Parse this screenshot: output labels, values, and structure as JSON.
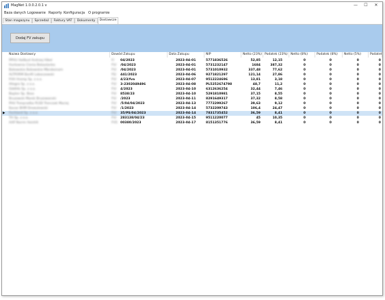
{
  "app": {
    "title": "MagNet 1.0.0.2.0.1 v"
  },
  "window_buttons": {
    "minimize": "—",
    "maximize": "☐",
    "close": "✕"
  },
  "menu": [
    "Baza danych",
    "Logowanie",
    "Raporty",
    "Konfiguracja",
    "O programie"
  ],
  "tabs": [
    {
      "label": "Stan magazynu",
      "active": false
    },
    {
      "label": "Sprzedaż",
      "active": false
    },
    {
      "label": "Faktury VAT",
      "active": false
    },
    {
      "label": "Dokumenty",
      "active": false
    },
    {
      "label": "Dostawcze",
      "active": true
    }
  ],
  "toolbar": {
    "add_button": "Dodaj FV zakupu"
  },
  "table": {
    "columns": [
      "Nazwa Dostawcy",
      "Dowód Zakupu",
      "Data Zakupu",
      "NIP",
      "Netto (23%)",
      "Podatek (23%)",
      "Netto (8%)",
      "Podatek (8%)",
      "Netto (5%)",
      "Podatek"
    ],
    "rows": [
      {
        "supplier": "PPHU Hallbud Andrzej Hibel",
        "doc_prefix": "F/",
        "doc": "04/2023",
        "date": "2023-04-01",
        "nip": "5771836526",
        "n23": "52,85",
        "p23": "12,15",
        "n8": "0",
        "p8": "0",
        "n5": "0",
        "p5": "0"
      },
      {
        "supplier": "Hurtownia Cienia Bekastanka",
        "doc_prefix": "FV/",
        "doc": "/04/2023",
        "date": "2023-04-01",
        "nip": "5731232147",
        "n23": "1684",
        "p23": "387,32",
        "n8": "0",
        "p8": "0",
        "n5": "0",
        "p5": "0"
      },
      {
        "supplier": "Bokowskie Bokowskie Mbrokeinzm",
        "doc_prefix": "FV/",
        "doc": "/04/2023",
        "date": "2023-04-01",
        "nip": "5731010932",
        "n23": "337,48",
        "p23": "77,62",
        "n8": "0",
        "p8": "0",
        "n5": "0",
        "p5": "0"
      },
      {
        "supplier": "ALTPORM Bonfil Loboczewski",
        "doc_prefix": "FS/",
        "doc": "441/2023",
        "date": "2023-04-06",
        "nip": "9271821297",
        "n23": "121,14",
        "p23": "27,86",
        "n8": "0",
        "p8": "0",
        "n5": "0",
        "p5": "0"
      },
      {
        "supplier": "FHH Hromp Sp. z o.o.",
        "doc_prefix": "FV/",
        "doc": "4/23/fva",
        "date": "2023-04-07",
        "nip": "9512224696",
        "n23": "13,81",
        "p23": "3,18",
        "n8": "0",
        "p8": "0",
        "n5": "0",
        "p5": "0"
      },
      {
        "supplier": "Allegro Sp. z o.o.",
        "doc_prefix": "FV/",
        "doc": "3-2302049496",
        "date": "2023-04-08",
        "nip": "PL5252674798",
        "n23": "48,7",
        "p23": "11,2",
        "n8": "0",
        "p8": "0",
        "n5": "0",
        "p5": "0"
      },
      {
        "supplier": "Oddhfo Sp. z o.o.",
        "doc_prefix": "FV/",
        "doc": "4/2023",
        "date": "2023-04-10",
        "nip": "6312636254",
        "n23": "32,44",
        "p23": "7,46",
        "n8": "0",
        "p8": "0",
        "n5": "0",
        "p5": "0"
      },
      {
        "supplier": "Beplen Sp. Boss",
        "doc_prefix": "FV/",
        "doc": "8538/23",
        "date": "2023-04-10",
        "nip": "5291810981",
        "n23": "37,15",
        "p23": "8,55",
        "n8": "0",
        "p8": "0",
        "n5": "0",
        "p5": "0"
      },
      {
        "supplier": "Bruzowski Marek Bruzowanski",
        "doc_prefix": "FV/",
        "doc": "/2023",
        "date": "2023-04-11",
        "nip": "8291649317",
        "n23": "37,32",
        "p23": "8,58",
        "n8": "0",
        "p8": "0",
        "n5": "0",
        "p5": "0"
      },
      {
        "supplier": "PHU Tronpradka PLSD Tronczak Maciej",
        "doc_prefix": "FV/",
        "doc": "/5/04/04/2023",
        "date": "2023-04-13",
        "nip": "7772299267",
        "n23": "39,63",
        "p23": "9,12",
        "n8": "0",
        "p8": "0",
        "n5": "0",
        "p5": "0"
      },
      {
        "supplier": "Kavax BHM Drewutewski",
        "doc_prefix": "FV/",
        "doc": "/1/2023",
        "date": "2023-04-14",
        "nip": "5732209743",
        "n23": "106,4",
        "p23": "24,47",
        "n8": "0",
        "p8": "0",
        "n5": "0",
        "p5": "0"
      },
      {
        "supplier": "Fechland Sp. z o.o.",
        "doc_prefix": "FV/",
        "doc": "35/PS/04/2023",
        "date": "2023-04-14",
        "nip": "7831735452",
        "n23": "36,59",
        "p23": "8,41",
        "n8": "0",
        "p8": "0",
        "n5": "0",
        "p5": "0"
      },
      {
        "supplier": "TH Sp. z o.o.",
        "doc_prefix": "FV/",
        "doc": "283138/04/23",
        "date": "2023-04-15",
        "nip": "9511220077",
        "n23": "45",
        "p23": "10,35",
        "n8": "0",
        "p8": "0",
        "n5": "0",
        "p5": "0"
      },
      {
        "supplier": "AAP Norrm Heinhlt",
        "doc_prefix": "FVS",
        "doc": "00380/2023",
        "date": "2023-04-17",
        "nip": "8151351776",
        "n23": "36,59",
        "p23": "8,41",
        "n8": "0",
        "p8": "0",
        "n5": "0",
        "p5": "0"
      }
    ],
    "selected_row": 11,
    "row_indicator": "▶"
  },
  "colors": {
    "panel_blue": "#a9cbed",
    "selected_row": "#cfe3f6"
  }
}
